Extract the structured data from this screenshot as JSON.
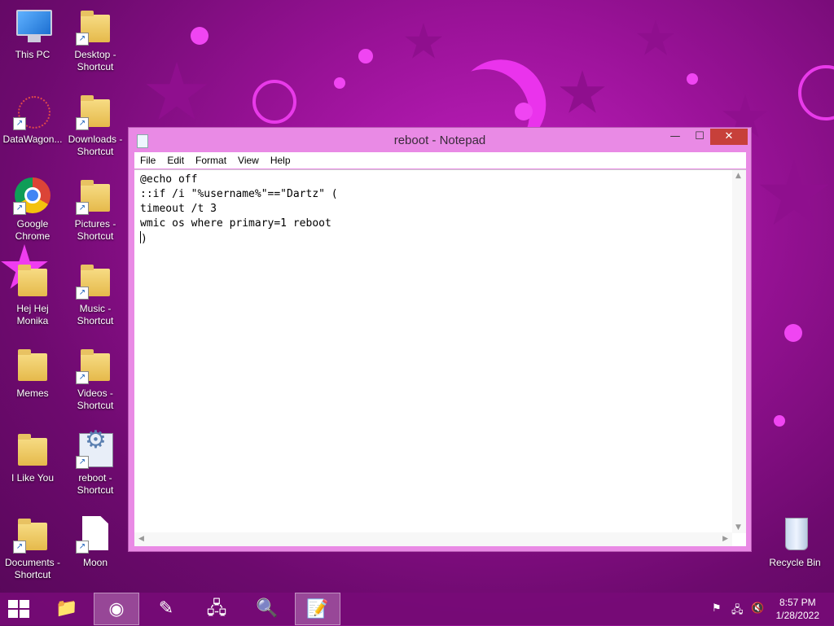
{
  "desktop": {
    "icons": [
      {
        "label": "This PC",
        "icon": "computer-icon"
      },
      {
        "label": "Desktop - Shortcut",
        "icon": "folder-icon"
      },
      {
        "label": "DataWagon...",
        "icon": "web-icon"
      },
      {
        "label": "Downloads - Shortcut",
        "icon": "folder-icon"
      },
      {
        "label": "Google Chrome",
        "icon": "chrome-icon"
      },
      {
        "label": "Pictures - Shortcut",
        "icon": "folder-icon"
      },
      {
        "label": "Hej Hej Monika",
        "icon": "folder-icon"
      },
      {
        "label": "Music - Shortcut",
        "icon": "folder-icon"
      },
      {
        "label": "Memes",
        "icon": "folder-icon"
      },
      {
        "label": "Videos - Shortcut",
        "icon": "folder-icon"
      },
      {
        "label": "I Like You",
        "icon": "folder-icon"
      },
      {
        "label": "reboot - Shortcut",
        "icon": "batch-file-icon"
      },
      {
        "label": "Documents - Shortcut",
        "icon": "folder-icon"
      },
      {
        "label": "Moon",
        "icon": "document-icon"
      },
      {
        "label": "Recycle Bin",
        "icon": "recycle-bin-icon"
      }
    ]
  },
  "notepad": {
    "title": "reboot - Notepad",
    "controls": {
      "minimize": "—",
      "maximize": "☐",
      "close": "✕"
    },
    "menu": [
      "File",
      "Edit",
      "Format",
      "View",
      "Help"
    ],
    "lines": [
      "@echo off",
      "::if /i \"%username%\"==\"Dartz\" (",
      "timeout /t 3",
      "wmic os where primary=1 reboot",
      ")"
    ]
  },
  "taskbar": {
    "start_icon": "windows-start-icon",
    "apps": [
      {
        "name": "file-explorer-icon",
        "glyph": "📁",
        "active": false
      },
      {
        "name": "chrome-icon",
        "glyph": "◉",
        "active": true
      },
      {
        "name": "notepad-plus-plus-icon",
        "glyph": "✎",
        "active": false
      },
      {
        "name": "network-app-icon",
        "glyph": "🖧",
        "active": false
      },
      {
        "name": "magnifier-icon",
        "glyph": "🔍",
        "active": false
      },
      {
        "name": "notepad-icon",
        "glyph": "📝",
        "active": true
      }
    ],
    "tray": {
      "flag": "⚑",
      "network": "🖧",
      "volume": "🔇"
    },
    "time": "8:57 PM",
    "date": "1/28/2022"
  }
}
